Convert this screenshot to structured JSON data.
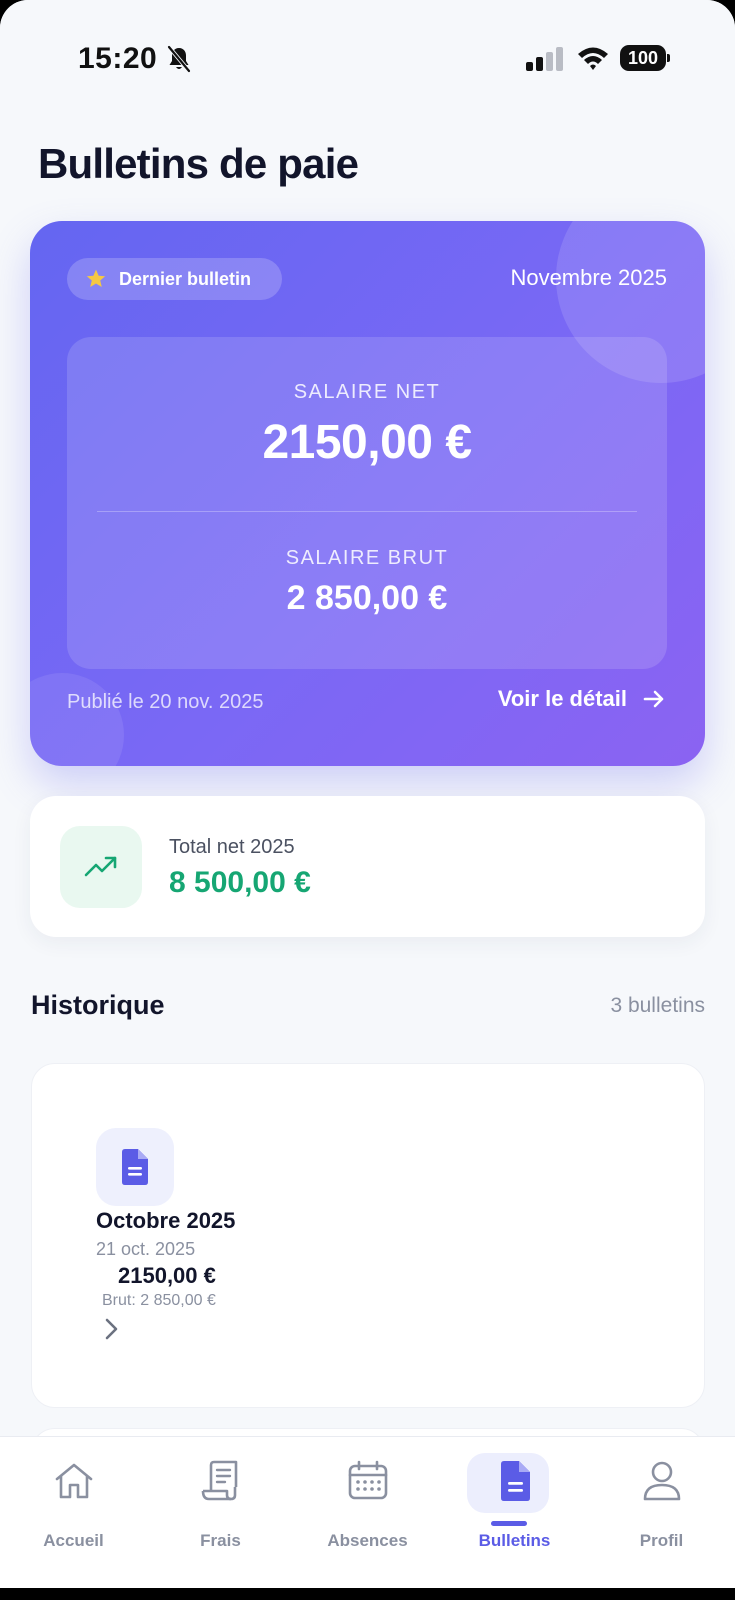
{
  "status_bar": {
    "time": "15:20",
    "battery": "100"
  },
  "header": {
    "title": "Bulletins de paie"
  },
  "latest": {
    "badge_label": "Dernier bulletin",
    "month": "Novembre 2025",
    "net_label": "SALAIRE NET",
    "net_value": "2150,00 €",
    "brut_label": "SALAIRE BRUT",
    "brut_value": "2 850,00 €",
    "published": "Publié le 20 nov. 2025",
    "detail_link": "Voir le détail"
  },
  "total": {
    "label": "Total net 2025",
    "value": "8 500,00 €"
  },
  "history": {
    "title": "Historique",
    "count": "3 bulletins",
    "items": [
      {
        "month": "Octobre 2025",
        "date": "21 oct. 2025",
        "net": "2150,00 €",
        "brut": "Brut: 2 850,00 €"
      }
    ]
  },
  "tabs": [
    {
      "label": "Accueil",
      "icon": "home-icon"
    },
    {
      "label": "Frais",
      "icon": "receipt-icon"
    },
    {
      "label": "Absences",
      "icon": "calendar-icon"
    },
    {
      "label": "Bulletins",
      "icon": "document-icon",
      "active": true
    },
    {
      "label": "Profil",
      "icon": "user-icon"
    }
  ],
  "colors": {
    "accent": "#5b5ce6",
    "hero_gradient_start": "#6466f1",
    "hero_gradient_end": "#8b63f2",
    "positive": "#16a673",
    "star": "#f5c842"
  }
}
